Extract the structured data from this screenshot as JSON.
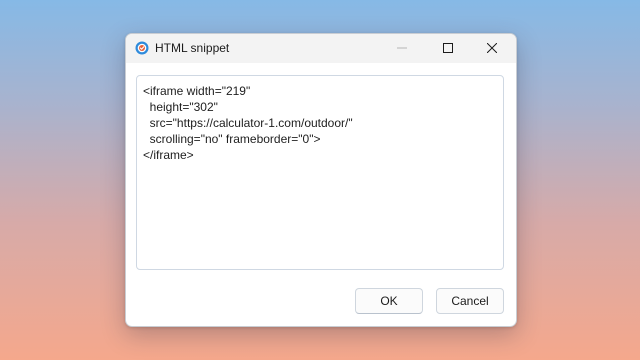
{
  "window": {
    "title": "HTML snippet",
    "app_icon": "app-logo-icon",
    "controls": {
      "minimize_icon": "minimize-icon",
      "maximize_icon": "maximize-icon",
      "close_icon": "close-icon"
    }
  },
  "snippet": {
    "text": "<iframe width=\"219\"\n  height=\"302\"\n  src=\"https://calculator-1.com/outdoor/\"\n  scrolling=\"no\" frameborder=\"0\">\n</iframe>"
  },
  "buttons": {
    "ok_label": "OK",
    "cancel_label": "Cancel"
  },
  "colors": {
    "icon_blue": "#2e8bdc",
    "icon_orange": "#e8623b"
  }
}
